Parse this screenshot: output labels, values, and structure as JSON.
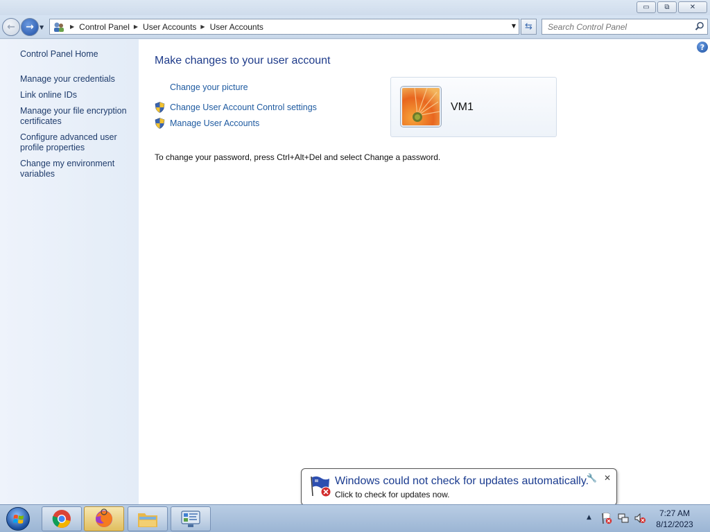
{
  "window": {
    "minimize_glyph": "▭",
    "maximize_glyph": "⧉",
    "close_glyph": "✕"
  },
  "address": {
    "breadcrumbs": [
      "Control Panel",
      "User Accounts",
      "User Accounts"
    ],
    "search_placeholder": "Search Control Panel"
  },
  "sidebar": {
    "home": "Control Panel Home",
    "items": [
      {
        "label": "Manage your credentials"
      },
      {
        "label": "Link online IDs"
      },
      {
        "label": "Manage your file encryption certificates"
      },
      {
        "label": "Configure advanced user profile properties"
      },
      {
        "label": "Change my environment variables"
      }
    ]
  },
  "main": {
    "heading": "Make changes to your user account",
    "links": [
      {
        "label": "Change your picture",
        "icon": "none"
      },
      {
        "label": "Change User Account Control settings",
        "icon": "shield-icon"
      },
      {
        "label": "Manage User Accounts",
        "icon": "shield-icon"
      }
    ],
    "password_note": "To change your password, press Ctrl+Alt+Del and select Change a password.",
    "user": {
      "name": "VM1"
    }
  },
  "notification": {
    "title": "Windows could not check for updates automatically.",
    "text": "Click to check for updates now."
  },
  "taskbar": {
    "apps": [
      "chrome",
      "firefox",
      "windows-explorer",
      "control-panel"
    ],
    "clock_time": "7:27 AM",
    "clock_date": "8/12/2023"
  },
  "colors": {
    "link": "#1e5aa0",
    "heading": "#1e3b8a",
    "sidebar_bg": "#e3ecf7"
  }
}
